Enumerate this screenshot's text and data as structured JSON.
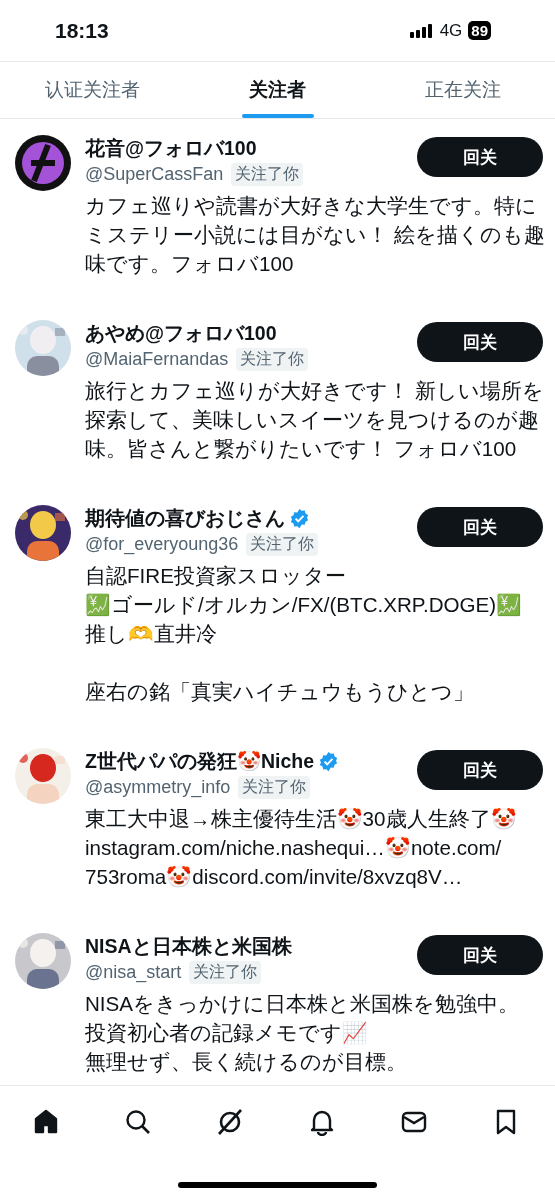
{
  "status_bar": {
    "time": "18:13",
    "network": "4G",
    "battery": "89"
  },
  "tabs": [
    {
      "label": "认证关注者",
      "selected": false
    },
    {
      "label": "关注者",
      "selected": true
    },
    {
      "label": "正在关注",
      "selected": false
    }
  ],
  "users": [
    {
      "avatar": {
        "kind": "logo"
      },
      "name": "花音@フォロバ100",
      "verified": false,
      "handle": "@SuperCassFan",
      "badge": "关注了你",
      "button": "回关",
      "bio": [
        [
          "カフェ巡りや読書が大好きな大学生です。特にミステリー小説には目がない！ 絵を描くのも趣味です。フォロバ100"
        ]
      ]
    },
    {
      "avatar": {
        "kind": "picture"
      },
      "name": "あやめ@フォロバ100",
      "verified": false,
      "handle": "@MaiaFernandas",
      "badge": "关注了你",
      "button": "回关",
      "bio": [
        [
          "旅行とカフェ巡りが大好きです！ 新しい場所を探索して、美味しいスイーツを見つけるのが趣味。皆さんと繋がりたいです！ フォロバ100"
        ]
      ]
    },
    {
      "avatar": {
        "kind": "picture"
      },
      "name": "期待値の喜びおじさん",
      "verified": true,
      "handle": "@for_everyoung36",
      "badge": "关注了你",
      "button": "回关",
      "bio": [
        [
          "自認FIRE投資家スロッター",
          "💹ゴールド/オルカン/FX/(BTC.XRP.DOGE)💹",
          "推し🫶直井冷"
        ],
        [
          "座右の銘「真実ハイチュウもうひとつ」"
        ]
      ]
    },
    {
      "avatar": {
        "kind": "picture"
      },
      "name": "Z世代パパの発狂🤡Niche",
      "verified": true,
      "handle": "@asymmetry_info",
      "badge": "关注了你",
      "button": "回关",
      "bio": [
        [
          "東工大中退→株主優待生活🤡30歳人生終了🤡",
          "instagram.com/niche.nashequi…🤡note.com/",
          "753roma🤡discord.com/invite/8xvzq8V…"
        ]
      ]
    },
    {
      "avatar": {
        "kind": "picture"
      },
      "name": "NISAと日本株と米国株",
      "verified": false,
      "handle": "@nisa_start",
      "badge": "关注了你",
      "button": "回关",
      "bio": [
        [
          "NISAをきっかけに日本株と米国株を勉強中。",
          "投資初心者の記録メモです📈",
          "無理せず、長く続けるのが目標。"
        ]
      ]
    }
  ],
  "nav": [
    {
      "kind": "home",
      "selected": true
    },
    {
      "kind": "search",
      "selected": false
    },
    {
      "kind": "grok",
      "selected": false
    },
    {
      "kind": "bell",
      "selected": false
    },
    {
      "kind": "mail",
      "selected": false
    },
    {
      "kind": "bookmark",
      "selected": false
    }
  ]
}
